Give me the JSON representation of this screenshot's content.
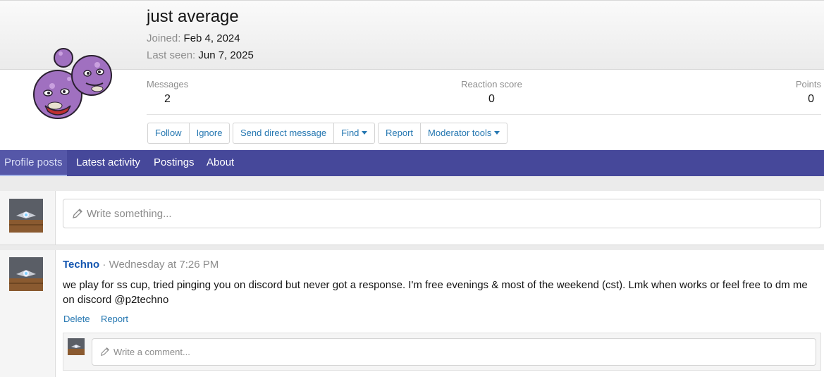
{
  "profile": {
    "username": "just average",
    "joined_label": "Joined:",
    "joined_value": "Feb 4, 2024",
    "last_seen_label": "Last seen:",
    "last_seen_value": "Jun 7, 2025",
    "avatar_icon": "weezing-pokemon-avatar",
    "stats": {
      "messages_label": "Messages",
      "messages_value": "2",
      "reaction_label": "Reaction score",
      "reaction_value": "0",
      "points_label": "Points",
      "points_value": "0"
    },
    "buttons": {
      "follow": "Follow",
      "ignore": "Ignore",
      "send_dm": "Send direct message",
      "find": "Find",
      "report": "Report",
      "moderator_tools": "Moderator tools"
    }
  },
  "tabs": [
    "Profile posts",
    "Latest activity",
    "Postings",
    "About"
  ],
  "active_tab": "Profile posts",
  "composer": {
    "placeholder": "Write something..."
  },
  "post": {
    "author": "Techno",
    "separator": " · ",
    "timestamp": "Wednesday at 7:26 PM",
    "body": "we play for ss cup, tried pinging you on discord but never got a response. I'm free evenings & most of the weekend (cst). Lmk when works or feel free to dm me on discord @p2techno",
    "actions": {
      "delete": "Delete",
      "report": "Report"
    },
    "comment_placeholder": "Write a comment..."
  },
  "colors": {
    "tabbar": "#46489a",
    "link": "#2577b1",
    "author": "#1456b0"
  }
}
